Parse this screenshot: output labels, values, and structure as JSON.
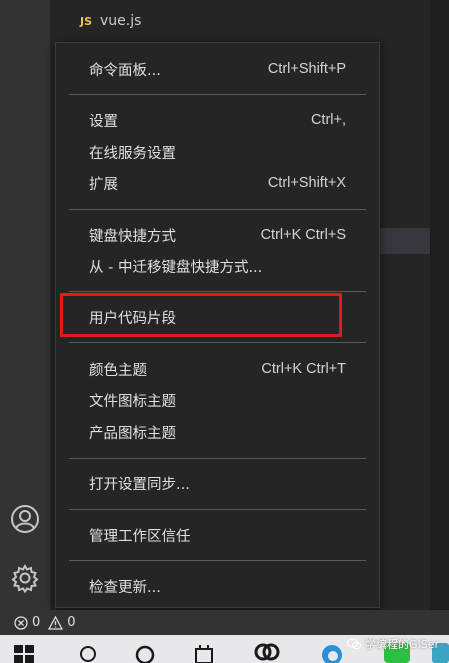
{
  "explorer": {
    "file_icon": "JS",
    "file_name": "vue.js"
  },
  "menu": {
    "items": [
      {
        "label": "命令面板...",
        "shortcut": "Ctrl+Shift+P"
      },
      {
        "label": "设置",
        "shortcut": "Ctrl+,"
      },
      {
        "label": "在线服务设置",
        "shortcut": ""
      },
      {
        "label": "扩展",
        "shortcut": "Ctrl+Shift+X"
      },
      {
        "label": "键盘快捷方式",
        "shortcut": "Ctrl+K Ctrl+S"
      },
      {
        "label": "从 - 中迁移键盘快捷方式...",
        "shortcut": ""
      },
      {
        "label": "用户代码片段",
        "shortcut": ""
      },
      {
        "label": "颜色主题",
        "shortcut": "Ctrl+K Ctrl+T"
      },
      {
        "label": "文件图标主题",
        "shortcut": ""
      },
      {
        "label": "产品图标主题",
        "shortcut": ""
      },
      {
        "label": "打开设置同步...",
        "shortcut": ""
      },
      {
        "label": "管理工作区信任",
        "shortcut": ""
      },
      {
        "label": "检查更新...",
        "shortcut": ""
      }
    ],
    "highlight_color": "#e01b1b"
  },
  "statusbar": {
    "errors": "0",
    "warnings": "0"
  },
  "watermark": {
    "text": "学编程的GISer"
  }
}
